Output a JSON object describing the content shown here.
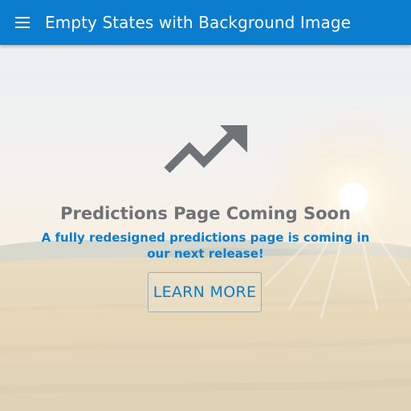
{
  "appbar": {
    "title": "Empty States with Background Image",
    "menu_icon": "menu-icon",
    "color": "#0b7dce"
  },
  "empty_state": {
    "icon": "trending-up-icon",
    "title": "Predictions Page Coming Soon",
    "subtitle": "A fully redesigned predictions page is coming in our next release!",
    "button_label": "LEARN MORE",
    "accent_color": "#0b7dce",
    "title_color": "#6f7378"
  },
  "background": {
    "description_icon": "field-sunrise-background"
  }
}
